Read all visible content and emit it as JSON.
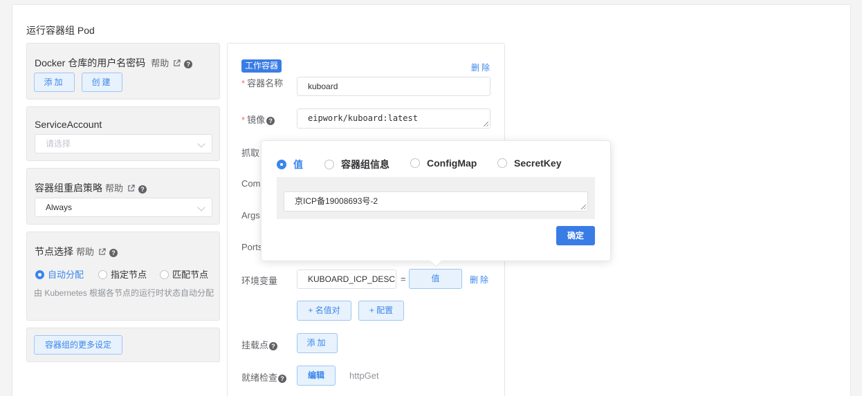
{
  "section_title": "运行容器组 Pod",
  "registry": {
    "title": "Docker 仓库的用户名密码",
    "help": "帮助",
    "add_label": "添加",
    "create_label": "创建"
  },
  "service_account": {
    "title": "ServiceAccount",
    "placeholder": "请选择"
  },
  "restart_policy": {
    "title": "容器组重启策略",
    "help": "帮助",
    "value": "Always"
  },
  "node_selection": {
    "title": "节点选择",
    "help": "帮助",
    "options": [
      "自动分配",
      "指定节点",
      "匹配节点"
    ],
    "selected": "自动分配",
    "description": "由 Kubernetes 根据各节点的运行时状态自动分配"
  },
  "more_settings_label": "容器组的更多设定",
  "container": {
    "tag": "工作容器",
    "delete_label": "删除",
    "name_label": "容器名称",
    "name_value": "kuboard",
    "image_label": "镜像",
    "image_value": "eipwork/kuboard:latest",
    "pull_label": "抓取",
    "command_label": "Com",
    "args_label": "Args",
    "ports_label": "Ports",
    "env_label": "环境变量",
    "env_key": "KUBOARD_ICP_DESC",
    "env_equals": "=",
    "env_value_button": "值",
    "env_delete_label": "删除",
    "add_kv_label": "+ 名值对",
    "add_config_label": "+ 配置",
    "mount_label": "挂载点",
    "mount_add_label": "添加",
    "readiness_label": "就绪检查",
    "readiness_edit_label": "编辑",
    "readiness_value": "httpGet"
  },
  "popover": {
    "options": [
      "值",
      "容器组信息",
      "ConfigMap",
      "SecretKey"
    ],
    "selected": "值",
    "value": "京ICP备19008693号-2",
    "confirm_label": "确定"
  },
  "colors": {
    "accent": "#3a86ec",
    "primary": "#3a7ce6",
    "required": "#f56c6c"
  }
}
